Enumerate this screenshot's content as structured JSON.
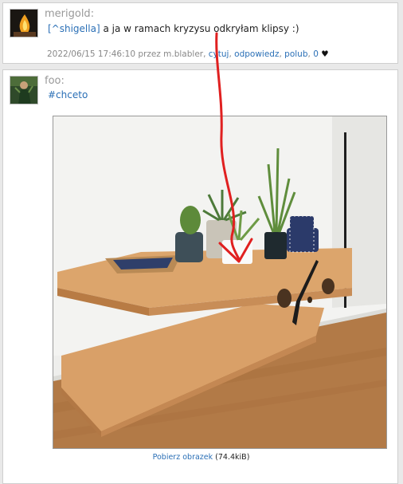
{
  "post1": {
    "author": "merigold:",
    "mention": "[^shigella]",
    "text": " a ja w ramach kryzysu odkryłam klipsy :)",
    "date": "2022/06/15 17:46:10 przez m.blabler,",
    "cytuj": "cytuj",
    "sep1": ", ",
    "odpowiedz": "odpowiedz",
    "sep2": ", ",
    "polub": "polub",
    "sep3": ", ",
    "likes": "0",
    "heart": "♥"
  },
  "post2": {
    "author": "foo:",
    "hashtag": "#chceto",
    "download_label": "Pobierz obrazek",
    "download_size": "(74.4kiB)"
  },
  "colors": {
    "link": "#2a6fb6",
    "arrow": "#e02020",
    "wood": "#d49a63"
  }
}
